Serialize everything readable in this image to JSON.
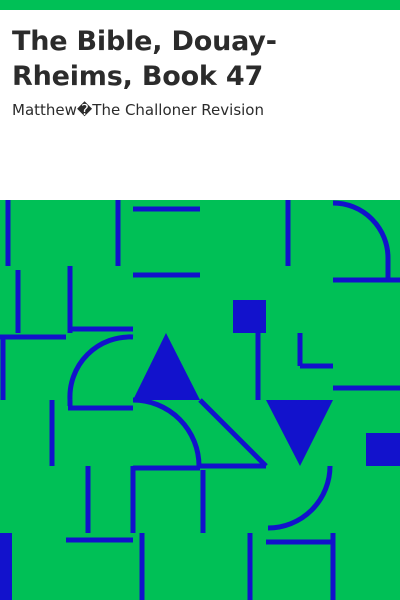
{
  "book": {
    "title": "The Bible, Douay-Rheims, Book 47",
    "subtitle": "Matthew�The Challoner Revision"
  },
  "colors": {
    "accent": "#00c056",
    "art_background": "#00c056",
    "art_shapes": "#1212cc",
    "text": "#2b2b2b"
  }
}
